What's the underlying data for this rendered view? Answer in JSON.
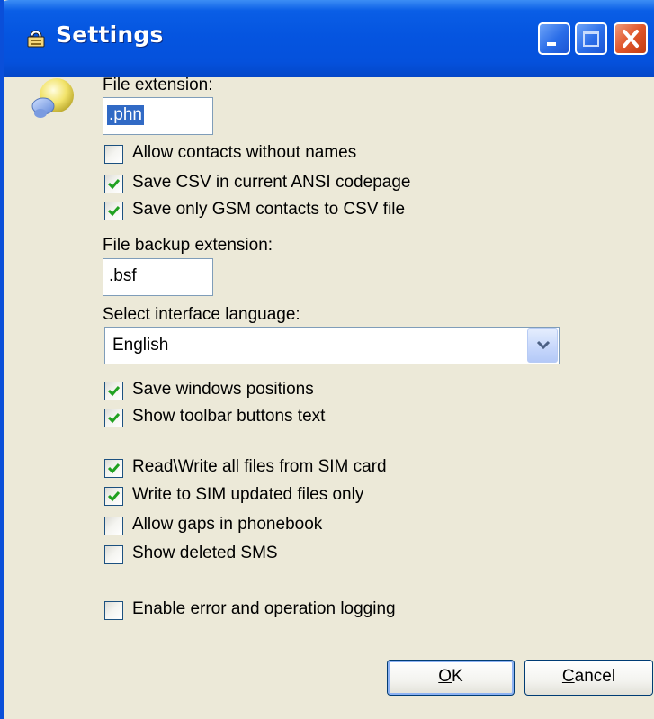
{
  "window": {
    "title": "Settings",
    "title_icon": "settings-app-icon",
    "controls": {
      "minimize": "minimize-icon",
      "maximize": "maximize-icon",
      "close": "close-icon"
    }
  },
  "content_icon": "settings-sphere-icon",
  "file_extension": {
    "label": "File extension:",
    "value": ".phn"
  },
  "options_group1": [
    {
      "label": "Allow contacts without names",
      "checked": false
    },
    {
      "label": "Save CSV in current ANSI codepage",
      "checked": true
    },
    {
      "label": "Save only GSM contacts to CSV file",
      "checked": true
    }
  ],
  "backup_extension": {
    "label": "File backup extension:",
    "value": ".bsf"
  },
  "language": {
    "label": "Select interface language:",
    "selected": "English"
  },
  "options_group2": [
    {
      "label": "Save windows positions",
      "checked": true
    },
    {
      "label": "Show toolbar buttons text",
      "checked": true
    }
  ],
  "options_group3": [
    {
      "label": "Read\\Write all files from SIM card",
      "checked": true
    },
    {
      "label": "Write to SIM updated files only",
      "checked": true
    },
    {
      "label": "Allow gaps in phonebook",
      "checked": false
    },
    {
      "label": "Show deleted SMS",
      "checked": false
    }
  ],
  "options_group4": [
    {
      "label": "Enable error and operation logging",
      "checked": false
    }
  ],
  "buttons": {
    "ok_mnemonic": "O",
    "ok_rest": "K",
    "cancel_mnemonic": "C",
    "cancel_rest": "ancel"
  },
  "colors": {
    "titlebar": "#0555e0",
    "dialog_bg": "#ece9d8",
    "selection": "#316ac5",
    "checkmark": "#21a121"
  }
}
